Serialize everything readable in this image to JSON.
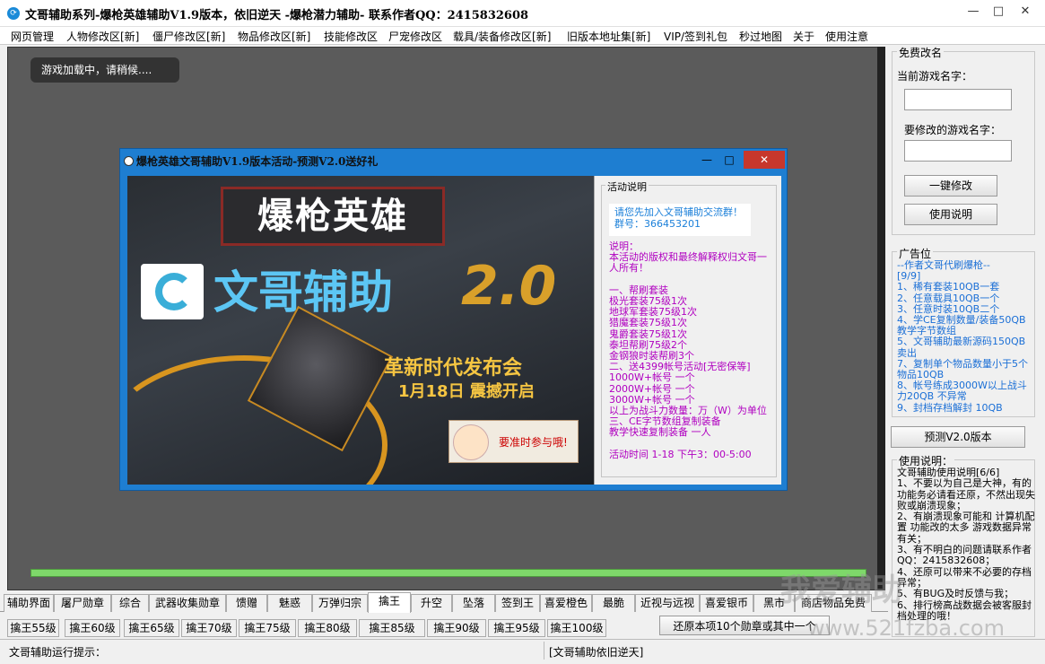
{
  "window": {
    "title": "文哥辅助系列-爆枪英雄辅助V1.9版本，依旧逆天  -爆枪潜力辅助- 联系作者QQ：2415832608",
    "min": "—",
    "max": "□",
    "close": "✕"
  },
  "menu": [
    "网页管理",
    "人物修改区[新]",
    "僵尸修改区[新]",
    "物品修改区[新]",
    "技能修改区",
    "尸宠修改区",
    "载具/装备修改区[新]",
    "旧版本地址集[新]",
    "VIP/签到礼包",
    "秒过地图",
    "关于",
    "使用注意"
  ],
  "game": {
    "loading": "游戏加载中，请稍候...."
  },
  "popup": {
    "title": "爆枪英雄文哥辅助V1.9版本活动-预测V2.0送好礼",
    "min": "—",
    "max": "□",
    "close": "✕",
    "banner": {
      "brand": "爆枪英雄",
      "assist": "文哥辅助",
      "version": "2.0",
      "event": "革新时代发布会",
      "date": "1月18日 震撼开启",
      "cta": "要准时参与哦!"
    },
    "panel": {
      "legend": "活动说明",
      "qq": "请您先加入文哥辅助交流群！群号：366453201",
      "body": "说明：\n本活动的版权和最终解释权归文哥一人所有！\n\n一、帮刷套装\n极光套装75级1次\n地球军套装75级1次\n猎魔套装75级1次\n鬼爵套装75级1次\n泰坦帮刷75级2个\n金钢狼时装帮刷3个\n二、送4399帐号活动[无密保等]\n1000W+帐号 一个\n2000W+帐号 一个\n3000W+帐号 一个\n以上为战斗力数量：万（W）为单位\n三、CE字节数组复制装备\n教学快速复制装备 一人\n\n活动时间 1-18 下午3：00-5:00"
    }
  },
  "right": {
    "rename_legend": "免费改名",
    "current_label": "当前游戏名字：",
    "current_value": "",
    "new_label": "要修改的游戏名字：",
    "new_value": "",
    "one_click": "一键修改",
    "howto": "使用说明",
    "ad_legend": "广告位",
    "ad_body": "--作者文哥代刷爆枪--\n[9/9]\n1、稀有套装10QB一套\n2、任意载具10QB一个\n3、任意时装10QB二个\n4、学CE复制数量/装备50QB教学字节数组\n5、文哥辅助最新源码150QB卖出\n7、复制单个物品数量小于5个物品10QB\n8、帐号练成3000W以上战斗力20QB 不异常\n9、封档存档解封 10QB",
    "predict_btn": "预测V2.0版本",
    "usage_legend": "使用说明：",
    "usage_body": "文哥辅助使用说明[6/6]\n1、不要以为自己是大神，有的功能务必请看还原，不然出现失败或崩溃现象；\n2、有崩溃现象可能和 计算机配置 功能改的太多 游戏数据异常 有关；\n3、有不明白的问题请联系作者QQ：2415832608；\n4、还原可以带来不必要的存档异常；\n5、有BUG及时反馈与我；\n6、排行榜高战数据会被客服封档处理的哦！"
  },
  "tabs": [
    "辅助界面",
    "屠尸勋章",
    "综合",
    "武器收集勋章",
    "馈赠",
    "魅惑",
    "万弹归宗",
    "擒王",
    "升空",
    "坠落",
    "签到王",
    "喜爱橙色",
    "最脆",
    "近视与远视",
    "喜爱银币",
    "黑市",
    "商店物品免费"
  ],
  "active_tab": "擒王",
  "subtabs": [
    "擒王55级",
    "擒王60级",
    "擒王65级",
    "擒王70级",
    "擒王75级",
    "擒王80级",
    "擒王85级",
    "擒王90级",
    "擒王95级",
    "擒王100级"
  ],
  "restore_btn": "还原本项10个勋章或其中一个",
  "status": {
    "left": "文哥辅助运行提示：",
    "right": "[文哥辅助依旧逆天]"
  },
  "watermark": {
    "text": "我爱辅助",
    "url": "www.521fzba.com"
  }
}
